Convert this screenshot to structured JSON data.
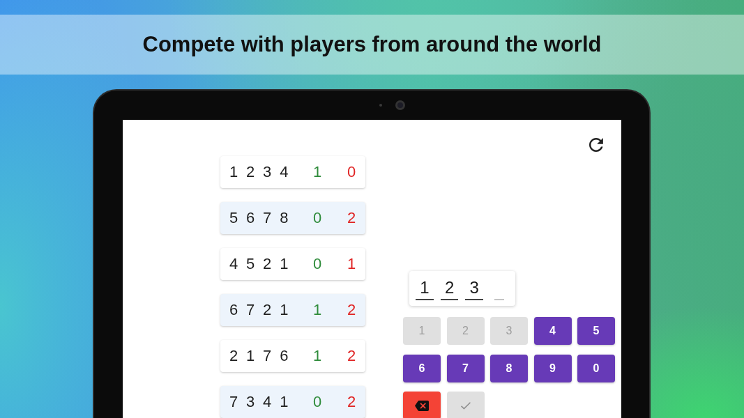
{
  "headline": "Compete with players from around the world",
  "guesses": [
    {
      "digits": [
        "1",
        "2",
        "3",
        "4"
      ],
      "bulls": "1",
      "cows": "0"
    },
    {
      "digits": [
        "5",
        "6",
        "7",
        "8"
      ],
      "bulls": "0",
      "cows": "2"
    },
    {
      "digits": [
        "4",
        "5",
        "2",
        "1"
      ],
      "bulls": "0",
      "cows": "1"
    },
    {
      "digits": [
        "6",
        "7",
        "2",
        "1"
      ],
      "bulls": "1",
      "cows": "2"
    },
    {
      "digits": [
        "2",
        "1",
        "7",
        "6"
      ],
      "bulls": "1",
      "cows": "2"
    },
    {
      "digits": [
        "7",
        "3",
        "4",
        "1"
      ],
      "bulls": "0",
      "cows": "2"
    }
  ],
  "entry": {
    "slots": [
      {
        "digit": "1",
        "filled": true
      },
      {
        "digit": "2",
        "filled": true
      },
      {
        "digit": "3",
        "filled": true
      },
      {
        "filled": false
      }
    ]
  },
  "keypad": {
    "keys": [
      {
        "kind": "digit",
        "label": "1",
        "disabled": true
      },
      {
        "kind": "digit",
        "label": "2",
        "disabled": true
      },
      {
        "kind": "digit",
        "label": "3",
        "disabled": true
      },
      {
        "kind": "digit",
        "label": "4",
        "disabled": false
      },
      {
        "kind": "digit",
        "label": "5",
        "disabled": false
      },
      {
        "kind": "digit",
        "label": "6",
        "disabled": false
      },
      {
        "kind": "digit",
        "label": "7",
        "disabled": false
      },
      {
        "kind": "digit",
        "label": "8",
        "disabled": false
      },
      {
        "kind": "digit",
        "label": "9",
        "disabled": false
      },
      {
        "kind": "digit",
        "label": "0",
        "disabled": false
      },
      {
        "kind": "backspace",
        "disabled": false
      },
      {
        "kind": "submit",
        "disabled": true
      }
    ]
  }
}
